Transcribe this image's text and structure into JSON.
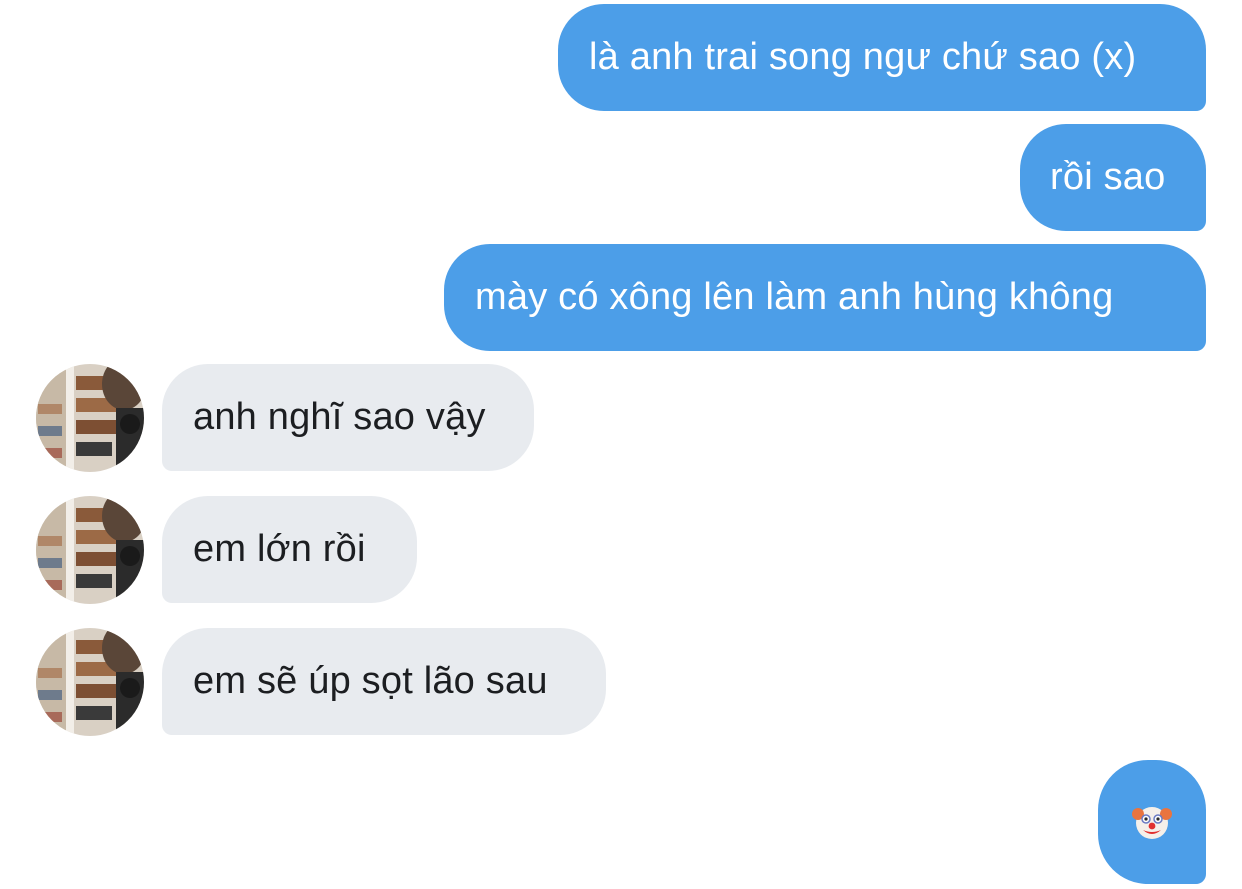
{
  "messages": [
    {
      "from": "me",
      "text": "là anh trai song ngư chứ sao (x)"
    },
    {
      "from": "me",
      "text": "rồi sao"
    },
    {
      "from": "me",
      "text": "mày có xông lên làm anh hùng không"
    },
    {
      "from": "them",
      "text": "anh nghĩ sao vậy",
      "avatar": "user-avatar"
    },
    {
      "from": "them",
      "text": "em lớn rồi",
      "avatar": "user-avatar"
    },
    {
      "from": "them",
      "text": "em sẽ úp sọt lão sau",
      "avatar": "user-avatar"
    },
    {
      "from": "me",
      "text": "🤡",
      "emoji_name": "clown-face-emoji"
    }
  ],
  "colors": {
    "outgoing_bubble": "#4c9ee8",
    "incoming_bubble": "#e8ebef",
    "outgoing_text": "#ffffff",
    "incoming_text": "#1c1e21",
    "background": "#ffffff"
  }
}
